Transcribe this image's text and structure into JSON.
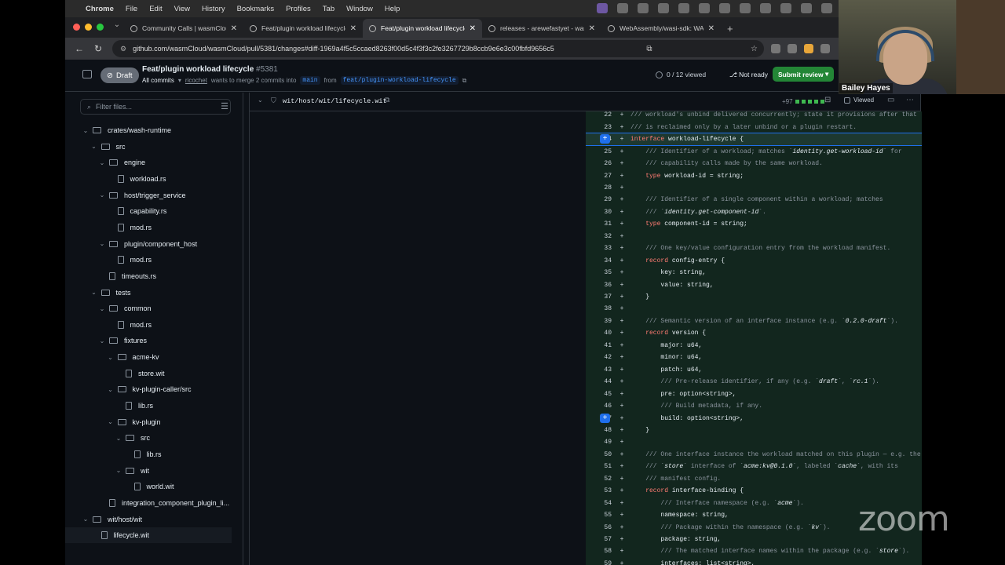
{
  "menubar": {
    "app": "Chrome",
    "items": [
      "File",
      "Edit",
      "View",
      "History",
      "Bookmarks",
      "Profiles",
      "Tab",
      "Window",
      "Help"
    ]
  },
  "tabs": [
    {
      "title": "Community Calls | wasmCloud",
      "active": false
    },
    {
      "title": "Feat/plugin workload lifecycle",
      "active": false
    },
    {
      "title": "Feat/plugin workload lifecycle",
      "active": true
    },
    {
      "title": "releases - arewefastyet - wasi",
      "active": false
    },
    {
      "title": "WebAssembly/wasi-sdk: WASI",
      "active": false
    }
  ],
  "url": "github.com/wasmCloud/wasmCloud/pull/5381/changes#diff-1969a4f5c5ccaed8263f00d5c4f3f3c2fe3267729b8ccb9e6e3c00fbfd9656c5",
  "pr": {
    "status": "Draft",
    "title": "Feat/plugin workload lifecycle",
    "number": "#5381",
    "commits": "All commits",
    "author": "ricochet",
    "merge_text": "wants to merge 2 commits into",
    "base": "main",
    "from_text": "from",
    "head": "feat/plugin-workload-lifecycle",
    "viewed": "0 / 12 viewed",
    "not_ready": "Not ready",
    "submit": "Submit review"
  },
  "tree": {
    "filter_placeholder": "Filter files...",
    "nodes": [
      {
        "label": "crates/wash-runtime",
        "type": "folder",
        "depth": 0
      },
      {
        "label": "src",
        "type": "folder",
        "depth": 1
      },
      {
        "label": "engine",
        "type": "folder",
        "depth": 2
      },
      {
        "label": "workload.rs",
        "type": "file",
        "depth": 3
      },
      {
        "label": "host/trigger_service",
        "type": "folder",
        "depth": 2
      },
      {
        "label": "capability.rs",
        "type": "file",
        "depth": 3
      },
      {
        "label": "mod.rs",
        "type": "file",
        "depth": 3
      },
      {
        "label": "plugin/component_host",
        "type": "folder",
        "depth": 2
      },
      {
        "label": "mod.rs",
        "type": "file",
        "depth": 3
      },
      {
        "label": "timeouts.rs",
        "type": "file",
        "depth": 2
      },
      {
        "label": "tests",
        "type": "folder",
        "depth": 1
      },
      {
        "label": "common",
        "type": "folder",
        "depth": 2
      },
      {
        "label": "mod.rs",
        "type": "file",
        "depth": 3
      },
      {
        "label": "fixtures",
        "type": "folder",
        "depth": 2
      },
      {
        "label": "acme-kv",
        "type": "folder",
        "depth": 3
      },
      {
        "label": "store.wit",
        "type": "file",
        "depth": 4
      },
      {
        "label": "kv-plugin-caller/src",
        "type": "folder",
        "depth": 3
      },
      {
        "label": "lib.rs",
        "type": "file",
        "depth": 4
      },
      {
        "label": "kv-plugin",
        "type": "folder",
        "depth": 3
      },
      {
        "label": "src",
        "type": "folder",
        "depth": 4
      },
      {
        "label": "lib.rs",
        "type": "file",
        "depth": 5
      },
      {
        "label": "wit",
        "type": "folder",
        "depth": 4
      },
      {
        "label": "world.wit",
        "type": "file",
        "depth": 5
      },
      {
        "label": "integration_component_plugin_li...",
        "type": "file",
        "depth": 2
      },
      {
        "label": "wit/host/wit",
        "type": "folder",
        "depth": 0
      },
      {
        "label": "lifecycle.wit",
        "type": "file",
        "depth": 1
      }
    ]
  },
  "diff": {
    "path": "wit/host/wit/lifecycle.wit",
    "stats": "+97",
    "viewed_label": "Viewed",
    "lines": [
      {
        "n": "22",
        "t": "/// workload's unbind delivered concurrently; state it provisions after that"
      },
      {
        "n": "23",
        "t": "/// is reclaimed only by a later unbind or a plugin restart."
      },
      {
        "n": "24",
        "t": "interface workload-lifecycle {"
      },
      {
        "n": "25",
        "t": "    /// Identifier of a workload; matches `identity.get-workload-id` for"
      },
      {
        "n": "26",
        "t": "    /// capability calls made by the same workload."
      },
      {
        "n": "27",
        "t": "    type workload-id = string;"
      },
      {
        "n": "28",
        "t": ""
      },
      {
        "n": "29",
        "t": "    /// Identifier of a single component within a workload; matches"
      },
      {
        "n": "30",
        "t": "    /// `identity.get-component-id`."
      },
      {
        "n": "31",
        "t": "    type component-id = string;"
      },
      {
        "n": "32",
        "t": ""
      },
      {
        "n": "33",
        "t": "    /// One key/value configuration entry from the workload manifest."
      },
      {
        "n": "34",
        "t": "    record config-entry {"
      },
      {
        "n": "35",
        "t": "        key: string,"
      },
      {
        "n": "36",
        "t": "        value: string,"
      },
      {
        "n": "37",
        "t": "    }"
      },
      {
        "n": "38",
        "t": ""
      },
      {
        "n": "39",
        "t": "    /// Semantic version of an interface instance (e.g. `0.2.0-draft`)."
      },
      {
        "n": "40",
        "t": "    record version {"
      },
      {
        "n": "41",
        "t": "        major: u64,"
      },
      {
        "n": "42",
        "t": "        minor: u64,"
      },
      {
        "n": "43",
        "t": "        patch: u64,"
      },
      {
        "n": "44",
        "t": "        /// Pre-release identifier, if any (e.g. `draft`, `rc.1`)."
      },
      {
        "n": "45",
        "t": "        pre: option<string>,"
      },
      {
        "n": "46",
        "t": "        /// Build metadata, if any."
      },
      {
        "n": "47",
        "t": "        build: option<string>,"
      },
      {
        "n": "48",
        "t": "    }"
      },
      {
        "n": "49",
        "t": ""
      },
      {
        "n": "50",
        "t": "    /// One interface instance the workload matched on this plugin — e.g. the"
      },
      {
        "n": "51",
        "t": "    /// `store` interface of `acme:kv@0.1.0`, labeled `cache`, with its"
      },
      {
        "n": "52",
        "t": "    /// manifest config."
      },
      {
        "n": "53",
        "t": "    record interface-binding {"
      },
      {
        "n": "54",
        "t": "        /// Interface namespace (e.g. `acme`)."
      },
      {
        "n": "55",
        "t": "        namespace: string,"
      },
      {
        "n": "56",
        "t": "        /// Package within the namespace (e.g. `kv`)."
      },
      {
        "n": "57",
        "t": "        package: string,"
      },
      {
        "n": "58",
        "t": "        /// The matched interface names within the package (e.g. `store`)."
      },
      {
        "n": "59",
        "t": "        interfaces: list<string>,"
      }
    ]
  },
  "webcam": {
    "name": "Bailey Hayes"
  },
  "watermark": "zoom"
}
